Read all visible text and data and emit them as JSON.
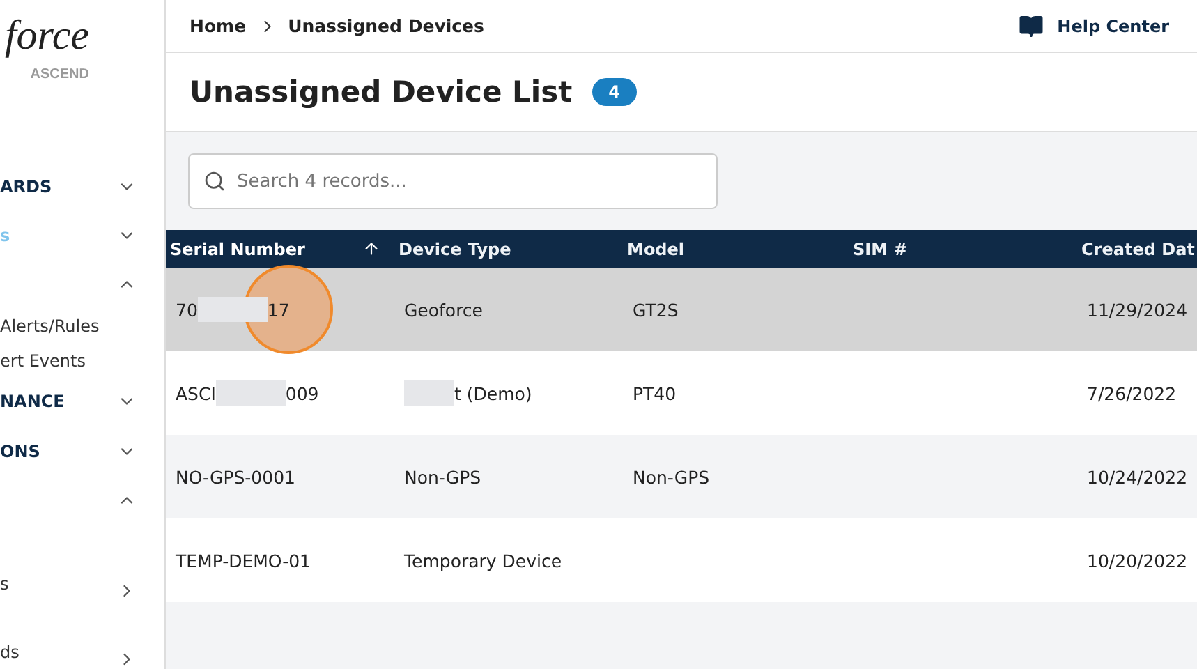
{
  "sidebar": {
    "logo": {
      "wordmark": "force",
      "subtitle": "ASCEND"
    },
    "items": [
      {
        "label": "ARDS",
        "expanded": false,
        "selected": false
      },
      {
        "label": "s",
        "expanded": false,
        "selected": true
      },
      {
        "expanded": true,
        "selected": false,
        "children": [
          {
            "label": "Alerts/Rules"
          },
          {
            "label": "ert Events"
          }
        ]
      },
      {
        "label": "NANCE",
        "expanded": false,
        "selected": false
      },
      {
        "label": "ONS",
        "expanded": false,
        "selected": false
      },
      {
        "expanded": true,
        "selected": false,
        "children": [
          {
            "label": "s",
            "kind": "link"
          },
          {
            "label": "ds",
            "kind": "link"
          }
        ]
      }
    ]
  },
  "breadcrumb": [
    "Home",
    "Unassigned Devices"
  ],
  "help": "Help Center",
  "title": "Unassigned Device List",
  "count": "4",
  "search": {
    "placeholder": "Search 4 records..."
  },
  "table": {
    "columns": [
      {
        "label": "Serial Number",
        "sorted": true
      },
      {
        "label": "Device Type",
        "sorted": false
      },
      {
        "label": "Model",
        "sorted": false
      },
      {
        "label": "SIM #",
        "sorted": false
      },
      {
        "label": "Created Dat",
        "sorted": false
      }
    ],
    "rows": [
      {
        "highlighted": true,
        "cells": [
          {
            "parts": [
              "70",
              "17"
            ],
            "redacted": true
          },
          {
            "parts": [
              "Geoforce"
            ],
            "redacted": false
          },
          {
            "parts": [
              "GT2S"
            ],
            "redacted": false
          },
          null,
          {
            "parts": [
              "11/29/2024"
            ],
            "redacted": false
          }
        ]
      },
      {
        "highlighted": false,
        "cells": [
          {
            "parts": [
              "ASCI",
              "009"
            ],
            "redacted": true
          },
          {
            "parts": [
              "t (Demo)"
            ],
            "redacted": true
          },
          {
            "parts": [
              "PT40"
            ],
            "redacted": false
          },
          null,
          {
            "parts": [
              "7/26/2022"
            ],
            "redacted": false
          }
        ]
      },
      {
        "highlighted": false,
        "cells": [
          {
            "parts": [
              "NO-GPS-0001"
            ],
            "redacted": false
          },
          {
            "parts": [
              "Non-GPS"
            ],
            "redacted": false
          },
          {
            "parts": [
              "Non-GPS"
            ],
            "redacted": false
          },
          null,
          {
            "parts": [
              "10/24/2022"
            ],
            "redacted": false
          }
        ]
      },
      {
        "highlighted": false,
        "cells": [
          {
            "parts": [
              "TEMP-DEMO-01"
            ],
            "redacted": false
          },
          {
            "parts": [
              "Temporary Device"
            ],
            "redacted": false
          },
          null,
          null,
          {
            "parts": [
              "10/20/2022"
            ],
            "redacted": false
          }
        ]
      }
    ]
  },
  "click_indicator": true
}
